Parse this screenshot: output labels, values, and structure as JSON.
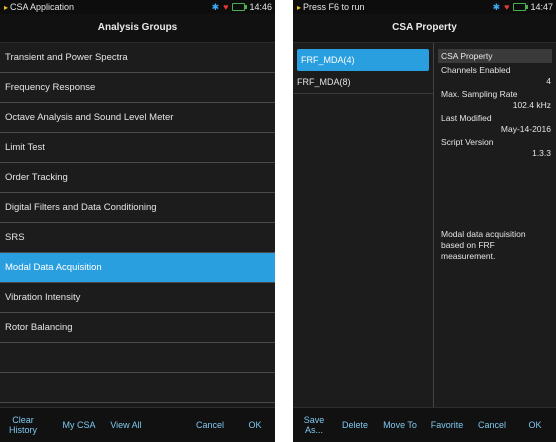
{
  "left_screen": {
    "status_title": "CSA Application",
    "time": "14:46",
    "header": "Analysis Groups",
    "items": [
      "Transient and Power Spectra",
      "Frequency Response",
      "Octave Analysis and Sound Level Meter",
      "Limit Test",
      "Order Tracking",
      "Digital Filters and Data Conditioning",
      "SRS",
      "Modal Data Acquisition",
      "Vibration Intensity",
      "Rotor Balancing"
    ],
    "selected_index": 7,
    "toolbar": {
      "clear_history": "Clear History",
      "my_csa": "My CSA",
      "view_all": "View All",
      "cancel": "Cancel",
      "ok": "OK"
    }
  },
  "right_screen": {
    "status_title": "Press F6 to run",
    "time": "14:47",
    "header": "CSA Property",
    "files": [
      "FRF_MDA(4)",
      "FRF_MDA(8)"
    ],
    "property": {
      "heading": "CSA Property",
      "channels_label": "Channels Enabled",
      "channels_value": "4",
      "rate_label": "Max. Sampling Rate",
      "rate_value": "102.4 kHz",
      "modified_label": "Last Modified",
      "modified_value": "May-14-2016",
      "version_label": "Script Version",
      "version_value": "1.3.3",
      "description": "Modal data acquisition based on FRF measurement."
    },
    "toolbar": {
      "save_as": "Save As...",
      "delete": "Delete",
      "move_to": "Move To",
      "favorite": "Favorite",
      "cancel": "Cancel",
      "ok": "OK"
    }
  },
  "colors": {
    "selection": "#2a9fe0",
    "toolbar_text": "#7fc9f0",
    "background": "#1c1c1c"
  }
}
